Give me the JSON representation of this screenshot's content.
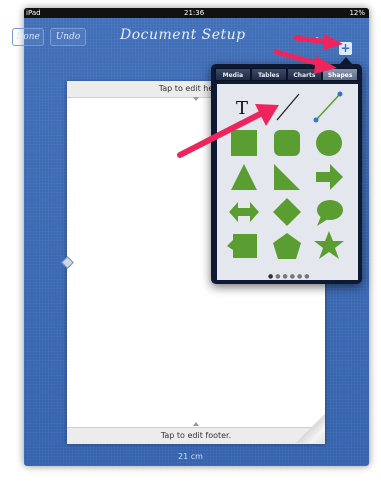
{
  "status_bar": {
    "carrier": "iPad",
    "time": "21:36",
    "battery": "12%"
  },
  "toolbar": {
    "done_label": "Done",
    "undo_label": "Undo",
    "title": "Document Setup",
    "dots": "• • •"
  },
  "document": {
    "header_text": "Tap to edit header.",
    "footer_text": "Tap to edit footer.",
    "size_label": "21 cm"
  },
  "popover": {
    "tabs": [
      "Media",
      "Tables",
      "Charts",
      "Shapes"
    ],
    "active_tab": "Shapes",
    "shapes": [
      "text-box",
      "line",
      "line-with-endpoints",
      "square",
      "rounded-square",
      "circle",
      "triangle",
      "right-triangle",
      "right-arrow",
      "double-arrow",
      "diamond",
      "speech-bubble",
      "callout-square",
      "pentagon",
      "star"
    ],
    "shape_color": "#5a9e32",
    "page_count": 6,
    "current_page": 1
  },
  "colors": {
    "background": "#3d6db7",
    "annotation_arrow": "#f0245c"
  }
}
